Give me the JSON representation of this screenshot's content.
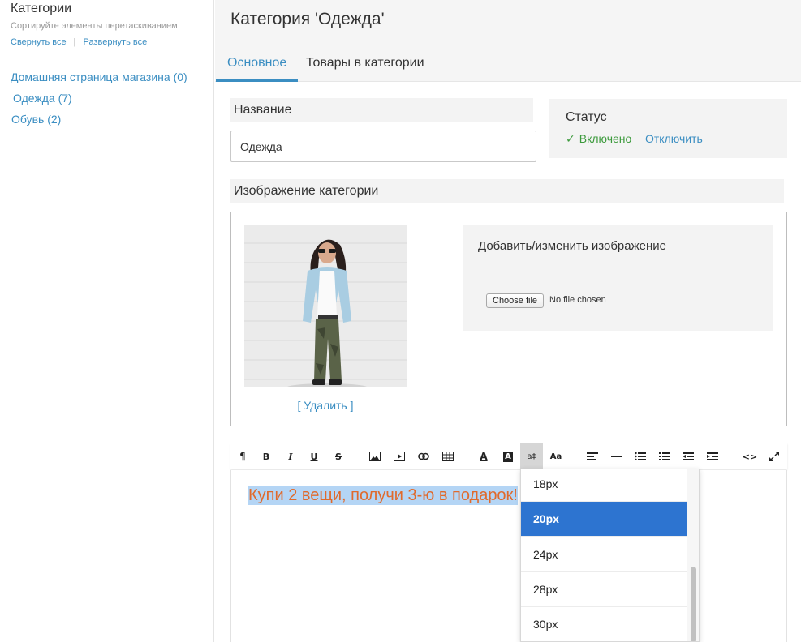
{
  "sidebar": {
    "title": "Категории",
    "hint": "Сортируйте элементы перетаскиванием",
    "collapse_all": "Свернуть все",
    "separator": "|",
    "expand_all": "Развернуть все",
    "tree": [
      {
        "label": "Домашняя страница магазина (0)"
      },
      {
        "label": "Одежда (7)"
      },
      {
        "label": "Обувь (2)"
      }
    ]
  },
  "header": {
    "title": "Категория 'Одежда'",
    "tabs": [
      {
        "label": "Основное",
        "active": true
      },
      {
        "label": "Товары в категории",
        "active": false
      }
    ]
  },
  "form": {
    "name_label": "Название",
    "name_value": "Одежда",
    "status_label": "Статус",
    "status_on": "Включено",
    "status_off": "Отключить",
    "image_label": "Изображение категории",
    "delete_link": "[ Удалить ]",
    "upload_title": "Добавить/изменить изображение",
    "file_button": "Choose file",
    "file_status": "No file chosen"
  },
  "editor": {
    "content": "Купи 2 вещи, получи 3-ю в подарок!",
    "content_color": "#e06a2c",
    "toolbar": [
      {
        "name": "paragraph-icon"
      },
      {
        "name": "bold-icon"
      },
      {
        "name": "italic-icon"
      },
      {
        "name": "underline-icon"
      },
      {
        "name": "strikethrough-icon"
      },
      {
        "name": "image-icon"
      },
      {
        "name": "video-icon"
      },
      {
        "name": "link-icon"
      },
      {
        "name": "table-icon"
      },
      {
        "name": "font-color-icon"
      },
      {
        "name": "background-color-icon"
      },
      {
        "name": "font-size-icon",
        "active": true
      },
      {
        "name": "case-icon"
      },
      {
        "name": "align-icon"
      },
      {
        "name": "horizontal-rule-icon"
      },
      {
        "name": "unordered-list-icon"
      },
      {
        "name": "ordered-list-icon"
      },
      {
        "name": "outdent-icon"
      },
      {
        "name": "indent-icon"
      },
      {
        "name": "html-icon"
      },
      {
        "name": "fullscreen-icon"
      }
    ],
    "font_sizes": [
      "18px",
      "20px",
      "24px",
      "28px",
      "30px"
    ],
    "selected_font_size": "20px"
  },
  "colors": {
    "link": "#3b8ec2",
    "success": "#3c9a3c",
    "selected": "#2d74d0"
  }
}
